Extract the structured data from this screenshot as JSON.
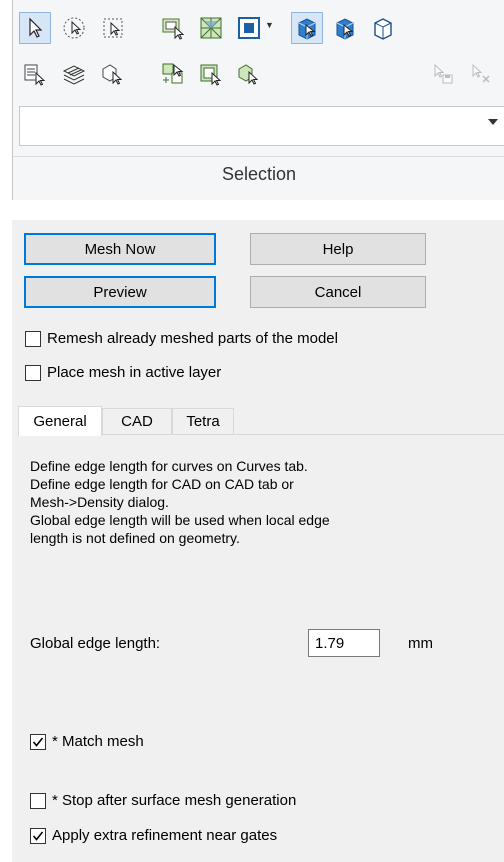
{
  "ribbon": {
    "group_label": "Selection",
    "combo_value": ""
  },
  "dialog": {
    "mesh_now_label": "Mesh Now",
    "help_label": "Help",
    "preview_label": "Preview",
    "cancel_label": "Cancel",
    "remesh_label": "Remesh already meshed parts of the model",
    "remesh_checked": false,
    "active_layer_label": "Place mesh in active layer",
    "active_layer_checked": false,
    "tabs": [
      {
        "label": "General",
        "active": true
      },
      {
        "label": "CAD",
        "active": false
      },
      {
        "label": "Tetra",
        "active": false
      }
    ],
    "general": {
      "description": [
        "Define edge length for curves on Curves tab.",
        "Define edge length for CAD on CAD tab or",
        "Mesh->Density dialog.",
        "Global edge length will be used when local edge",
        "length is not defined on geometry."
      ],
      "global_edge_label": "Global edge length:",
      "global_edge_value": "1.79",
      "global_edge_unit": "mm",
      "match_mesh_label": "* Match mesh",
      "match_mesh_checked": true,
      "stop_after_label": "* Stop after surface mesh generation",
      "stop_after_checked": false,
      "refinement_label": "Apply extra refinement near gates",
      "refinement_checked": true
    }
  }
}
